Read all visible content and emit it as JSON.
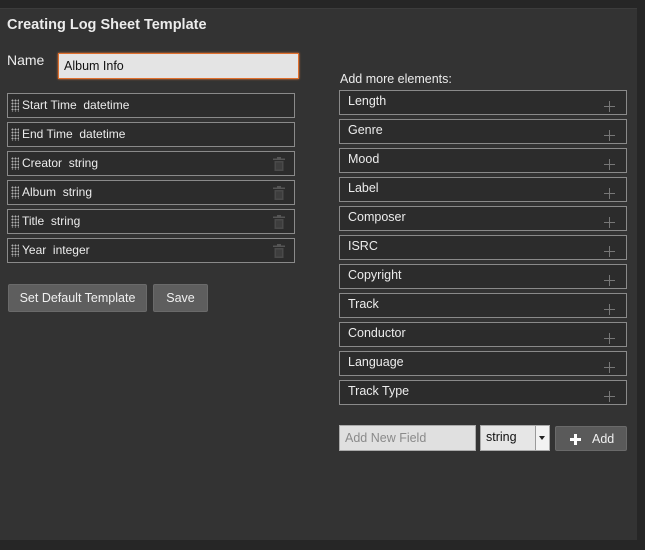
{
  "header": {
    "title": "Creating Log Sheet Template"
  },
  "name_field": {
    "label": "Name",
    "value": "Album Info"
  },
  "template_fields": [
    {
      "name": "Start Time",
      "type": "datetime",
      "removable": false
    },
    {
      "name": "End Time",
      "type": "datetime",
      "removable": false
    },
    {
      "name": "Creator",
      "type": "string",
      "removable": true
    },
    {
      "name": "Album",
      "type": "string",
      "removable": true
    },
    {
      "name": "Title",
      "type": "string",
      "removable": true
    },
    {
      "name": "Year",
      "type": "integer",
      "removable": true
    }
  ],
  "actions": {
    "default_label": "Set Default Template",
    "save_label": "Save"
  },
  "elements": {
    "heading": "Add more elements:",
    "items": [
      "Length",
      "Genre",
      "Mood",
      "Label",
      "Composer",
      "ISRC",
      "Copyright",
      "Track",
      "Conductor",
      "Language",
      "Track Type"
    ]
  },
  "new_field": {
    "placeholder": "Add New Field",
    "type_value": "string",
    "add_label": "Add"
  },
  "icons": {
    "grip": "drag-handle-icon",
    "remove": "trash-icon",
    "add": "plus-icon"
  },
  "colors": {
    "background": "#333333",
    "focus_border": "#e0702e",
    "row_border": "#8a8a8a",
    "button": "#5e5e5e"
  }
}
